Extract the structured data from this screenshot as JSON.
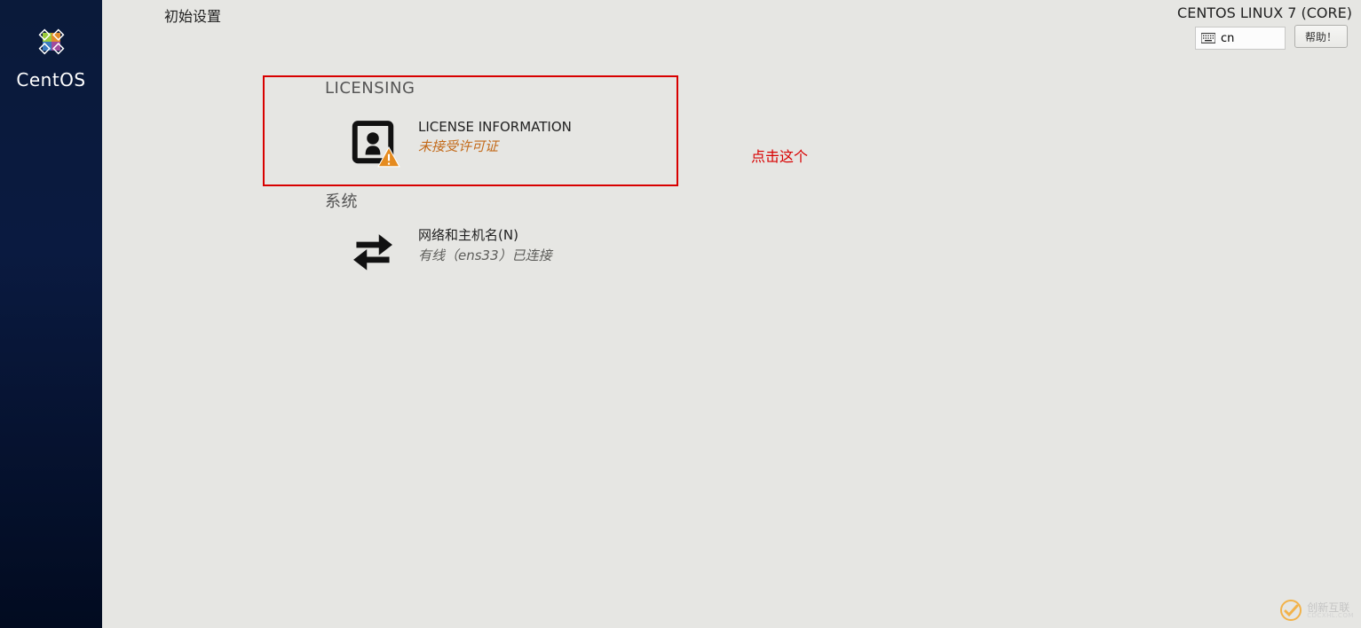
{
  "sidebar": {
    "product_name": "CentOS"
  },
  "header": {
    "page_title": "初始设置",
    "os_label": "CENTOS LINUX 7 (CORE)",
    "language_code": "cn",
    "help_label": "帮助！"
  },
  "annotation": {
    "text": "点击这个"
  },
  "sections": {
    "licensing": {
      "label": "LICENSING",
      "spoke": {
        "title": "LICENSE INFORMATION",
        "status": "未接受许可证",
        "status_type": "warning"
      }
    },
    "system": {
      "label": "系统",
      "spoke": {
        "title": "网络和主机名(N)",
        "status": "有线（ens33）已连接",
        "status_type": "ok"
      }
    }
  },
  "watermark": {
    "text": "创新互联",
    "sub": "CDCXHL.COM"
  }
}
